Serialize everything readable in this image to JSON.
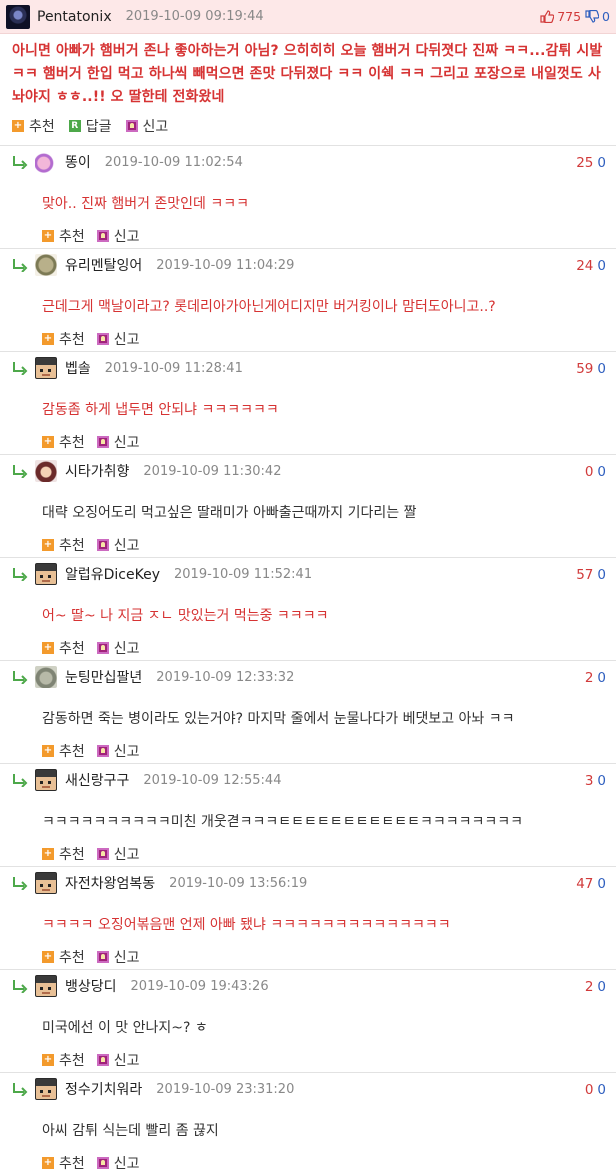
{
  "post": {
    "author": "Pentatonix",
    "date": "2019-10-09 09:19:44",
    "upvotes": "775",
    "downvotes": "0",
    "body": "아니면 아빠가 햄버거 존나 좋아하는거 아님? 으히히히 오늘 햄버거 다뒤졋다 진짜 ㅋㅋ...감튀 시발 ㅋㅋ 햄버거 한입 먹고 하나씩 빼먹으면 존맛 다뒤졌다 ㅋㅋ 이쉑 ㅋㅋ 그리고 포장으로 내일껏도 사놔야지 ㅎㅎ..!! 오 딸한테 전화왔네",
    "actions": {
      "recommend": "추천",
      "reply": "답글",
      "report": "신고"
    }
  },
  "comment_actions": {
    "recommend": "추천",
    "report": "신고"
  },
  "comments": [
    {
      "author": "똥이",
      "date": "2019-10-09 11:02:54",
      "up": "25",
      "down": "0",
      "text": "맞아.. 진짜 햄버거 존맛인데 ㅋㅋㅋ",
      "avatar": "unicorn-avatar",
      "text_color": "red"
    },
    {
      "author": "유리멘탈잉어",
      "date": "2019-10-09 11:04:29",
      "up": "24",
      "down": "0",
      "text": "근데그게 맥날이라고? 롯데리아가아닌게어디지만 버거킹이나 맘터도아니고..?",
      "avatar": "pinecone-avatar",
      "text_color": "red"
    },
    {
      "author": "벱솔",
      "date": "2019-10-09 11:28:41",
      "up": "59",
      "down": "0",
      "text": "감동좀 하게 냅두면 안되냐 ㅋㅋㅋㅋㅋㅋ",
      "avatar": "pixel-face-avatar",
      "text_color": "red"
    },
    {
      "author": "시타가취향",
      "date": "2019-10-09 11:30:42",
      "up": "0",
      "down": "0",
      "text": "대략 오징어도리 먹고싶은 딸래미가 아빠출근때까지 기다리는 짤",
      "avatar": "anime-girl-avatar",
      "text_color": "dark"
    },
    {
      "author": "알럽유DiceKey",
      "date": "2019-10-09 11:52:41",
      "up": "57",
      "down": "0",
      "text": "어~ 딸~ 나 지금 ㅈㄴ 맛있는거 먹는중 ㅋㅋㅋㅋ",
      "avatar": "pixel-face-avatar",
      "text_color": "red"
    },
    {
      "author": "눈팅만십팔년",
      "date": "2019-10-09 12:33:32",
      "up": "2",
      "down": "0",
      "text": "감동하면 죽는 병이라도 있는거야? 마지막 줄에서 눈물나다가 베댓보고 아놔 ㅋㅋ",
      "avatar": "cat-avatar",
      "text_color": "dark"
    },
    {
      "author": "새신랑구구",
      "date": "2019-10-09 12:55:44",
      "up": "3",
      "down": "0",
      "text": "ㅋㅋㅋㅋㅋㅋㅋㅋㅋㅋ미친 개웃겯ㅋㅋㅋㅌㅌㅌㅌㅌㅌㅌㅌㅌㅌㅌㅋㅋㅋㅋㅋㅋㅋㅋ",
      "avatar": "pixel-face-avatar",
      "text_color": "dark"
    },
    {
      "author": "자전차왕엄복동",
      "date": "2019-10-09 13:56:19",
      "up": "47",
      "down": "0",
      "text": "ㅋㅋㅋㅋ 오징어볶음맨 언제 아빠 됐냐 ㅋㅋㅋㅋㅋㅋㅋㅋㅋㅋㅋㅋㅋㅋ",
      "avatar": "pixel-face-avatar",
      "text_color": "red"
    },
    {
      "author": "뱅상당디",
      "date": "2019-10-09 19:43:26",
      "up": "2",
      "down": "0",
      "text": "미국에선 이 맛 안나지~? ㅎ",
      "avatar": "pixel-face-avatar",
      "text_color": "dark"
    },
    {
      "author": "정수기치워라",
      "date": "2019-10-09 23:31:20",
      "up": "0",
      "down": "0",
      "text": "아씨 감튀 식는데 빨리 좀 끊지",
      "avatar": "pixel-face-avatar",
      "text_color": "dark"
    }
  ]
}
